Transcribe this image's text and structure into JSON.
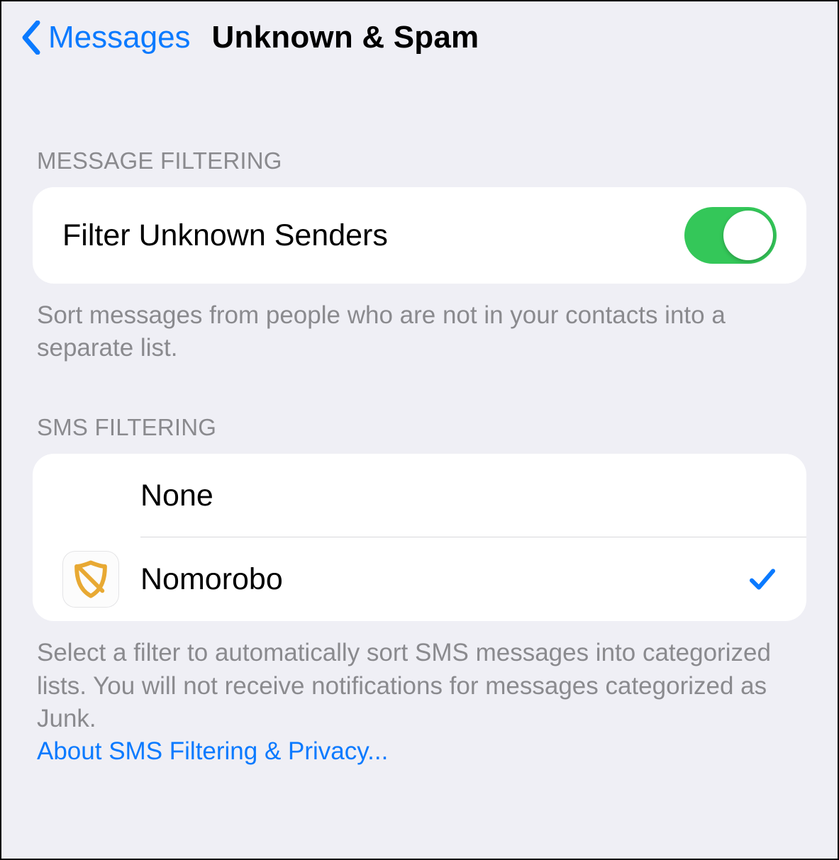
{
  "nav": {
    "back_label": "Messages",
    "title": "Unknown & Spam"
  },
  "message_filtering": {
    "header": "MESSAGE FILTERING",
    "toggle_label": "Filter Unknown Senders",
    "toggle_on": true,
    "footer": "Sort messages from people who are not in your contacts into a separate list."
  },
  "sms_filtering": {
    "header": "SMS FILTERING",
    "options": [
      {
        "label": "None",
        "selected": false,
        "icon": null
      },
      {
        "label": "Nomorobo",
        "selected": true,
        "icon": "nomorobo-shield"
      }
    ],
    "footer": "Select a filter to automatically sort SMS messages into categorized lists. You will not receive notifications for messages categorized as Junk.",
    "footer_link": "About SMS Filtering & Privacy..."
  },
  "colors": {
    "accent": "#0a7aff",
    "switch_on": "#34c759",
    "background": "#efeff5",
    "secondary_text": "#8a8a8e"
  }
}
